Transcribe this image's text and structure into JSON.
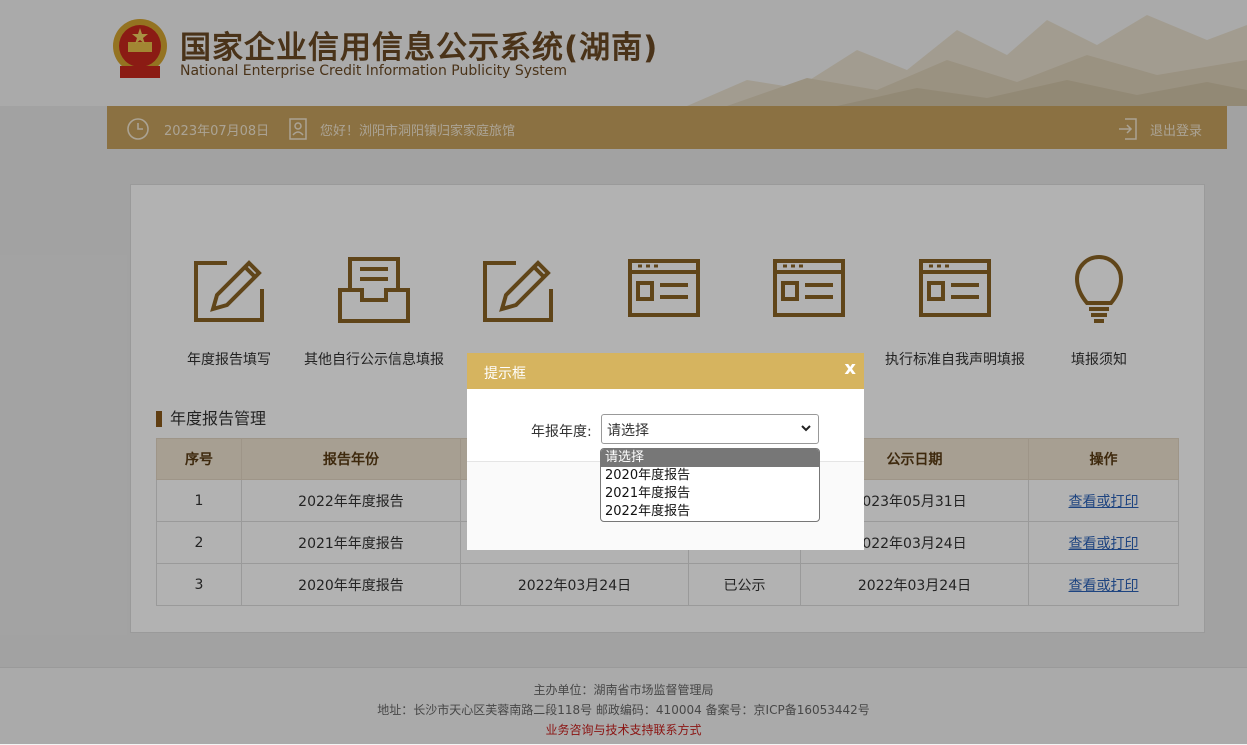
{
  "header": {
    "title_cn": "国家企业信用信息公示系统(湖南)",
    "title_en": "National Enterprise Credit Information Publicity System"
  },
  "infobar": {
    "date": "2023年07月08日",
    "greeting": "您好！浏阳市洞阳镇归家家庭旅馆",
    "logout": "退出登录"
  },
  "menu": [
    {
      "label": "年度报告填写",
      "icon": "pencil-square-icon"
    },
    {
      "label": "其他自行公示信息填报",
      "icon": "inbox-tray-icon"
    },
    {
      "label": "",
      "icon": "pencil-square-icon"
    },
    {
      "label": "",
      "icon": "window-card-icon"
    },
    {
      "label": "",
      "icon": "window-card-icon"
    },
    {
      "label": "执行标准自我声明填报",
      "icon": "window-card-icon"
    },
    {
      "label": "填报须知",
      "icon": "lightbulb-icon"
    }
  ],
  "section": {
    "title": "年度报告管理"
  },
  "table": {
    "headers": [
      "序号",
      "报告年份",
      "",
      "",
      "公示日期",
      "操作"
    ],
    "rows": [
      {
        "no": "1",
        "year": "2022年年度报告",
        "date": "",
        "status": "",
        "pub_date": "023年05月31日",
        "action": "查看或打印"
      },
      {
        "no": "2",
        "year": "2021年年度报告",
        "date": "",
        "status": "",
        "pub_date": "022年03月24日",
        "action": "查看或打印"
      },
      {
        "no": "3",
        "year": "2020年年度报告",
        "date": "2022年03月24日",
        "status": "已公示",
        "pub_date": "2022年03月24日",
        "action": "查看或打印"
      }
    ]
  },
  "footer": {
    "line1": "主办单位：湖南省市场监督管理局",
    "line2": "地址：长沙市天心区芙蓉南路二段118号 邮政编码：410004 备案号：京ICP备16053442号",
    "line3": "业务咨询与技术支持联系方式"
  },
  "dialog": {
    "title": "提示框",
    "close": "x",
    "field_label": "年报年度:",
    "selected": "请选择",
    "options": [
      "请选择",
      "2020年度报告",
      "2021年度报告",
      "2022年度报告"
    ]
  },
  "colors": {
    "brand_gold": "#c8a25f",
    "dialog_header": "#d6b45f",
    "icon_brown": "#8a6424",
    "link_blue": "#2b62b8"
  }
}
